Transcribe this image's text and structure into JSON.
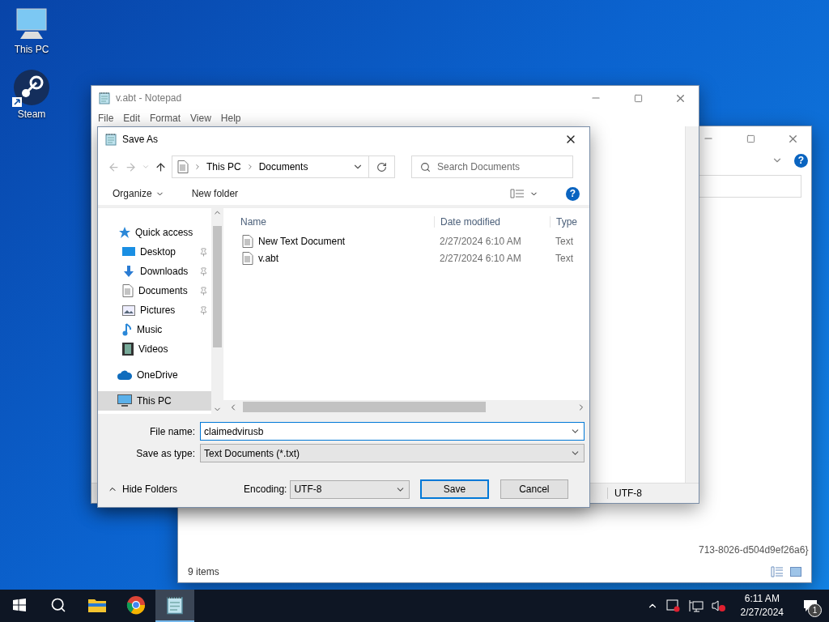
{
  "desktop_icons": [
    {
      "label": "This PC",
      "kind": "pc"
    },
    {
      "label": "Steam",
      "kind": "steam"
    }
  ],
  "explorer_window": {
    "help": "?",
    "path_fragment": "713-8026-d504d9ef26a6}",
    "status": "9 items"
  },
  "notepad": {
    "title": "v.abt - Notepad",
    "menu": [
      "File",
      "Edit",
      "Format",
      "View",
      "Help"
    ],
    "encoding": "UTF-8"
  },
  "save_dialog": {
    "title": "Save As",
    "breadcrumb": [
      "This PC",
      "Documents"
    ],
    "search": {
      "placeholder": "Search Documents"
    },
    "toolbar": {
      "organize": "Organize",
      "new_folder": "New folder",
      "help": "?"
    },
    "nav": [
      {
        "label": "Quick access",
        "kind": "star",
        "selected": false,
        "children": [
          {
            "label": "Desktop",
            "kind": "desktop",
            "pinned": true,
            "selected": false
          },
          {
            "label": "Downloads",
            "kind": "download",
            "pinned": true,
            "selected": false
          },
          {
            "label": "Documents",
            "kind": "document",
            "pinned": true,
            "selected": false
          },
          {
            "label": "Pictures",
            "kind": "picture",
            "pinned": true,
            "selected": false
          },
          {
            "label": "Music",
            "kind": "music",
            "pinned": false,
            "selected": false
          },
          {
            "label": "Videos",
            "kind": "video",
            "pinned": false,
            "selected": false
          }
        ]
      },
      {
        "label": "OneDrive",
        "kind": "cloud",
        "selected": false
      },
      {
        "label": "This PC",
        "kind": "pc",
        "selected": true
      }
    ],
    "columns": [
      "Name",
      "Date modified",
      "Type"
    ],
    "rows": [
      {
        "name": "New Text Document",
        "date": "2/27/2024 6:10 AM",
        "type": "Text"
      },
      {
        "name": "v.abt",
        "date": "2/27/2024 6:10 AM",
        "type": "Text"
      }
    ],
    "file_name": {
      "label": "File name:",
      "value": "claimedvirusb"
    },
    "save_type": {
      "label": "Save as type:",
      "value": "Text Documents (*.txt)"
    },
    "hide_folders": "Hide Folders",
    "encoding": {
      "label": "Encoding:",
      "value": "UTF-8"
    },
    "buttons": [
      {
        "label": "Save",
        "default": true
      },
      {
        "label": "Cancel",
        "default": false
      }
    ]
  },
  "taskbar": {
    "apps": [
      {
        "kind": "start",
        "active": false
      },
      {
        "kind": "search",
        "active": false
      },
      {
        "kind": "explorer",
        "active": false
      },
      {
        "kind": "chrome",
        "active": false
      },
      {
        "kind": "notepad",
        "active": true
      }
    ],
    "time": "6:11 AM",
    "date": "2/27/2024",
    "notifications": "1"
  }
}
